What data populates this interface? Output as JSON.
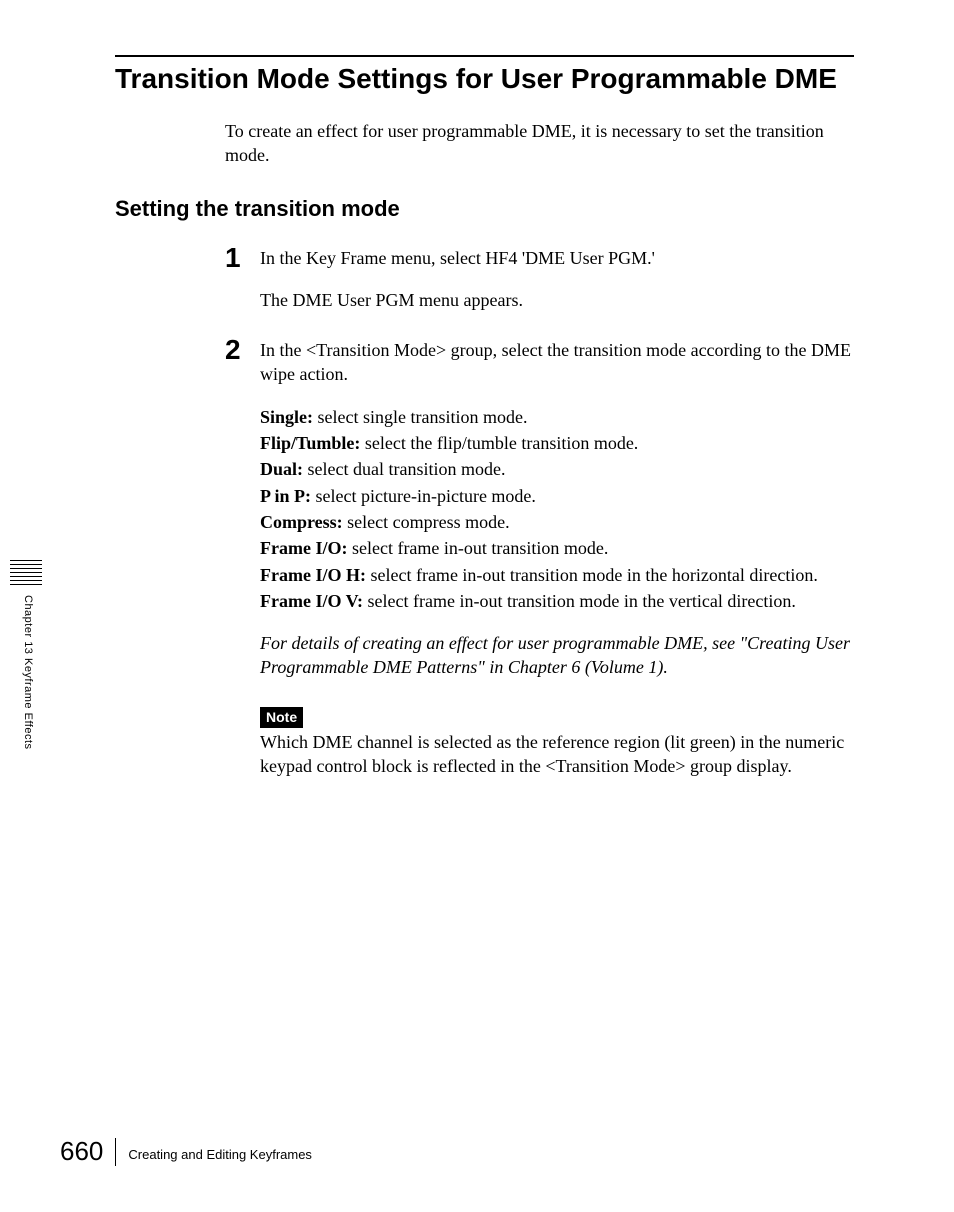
{
  "title": "Transition Mode Settings for User Programmable DME",
  "intro": "To create an effect for user programmable DME, it is necessary to set the transition mode.",
  "subhead": "Setting the transition mode",
  "step1": {
    "num": "1",
    "line1": "In the Key Frame menu, select HF4 'DME User PGM.'",
    "line2": "The DME User PGM menu appears."
  },
  "step2": {
    "num": "2",
    "intro": "In the <Transition Mode> group, select the transition mode according to the DME wipe action.",
    "defs": {
      "single_t": "Single:",
      "single_d": " select single transition mode.",
      "flip_t": "Flip/Tumble:",
      "flip_d": " select the flip/tumble transition mode.",
      "dual_t": "Dual:",
      "dual_d": " select dual transition mode.",
      "pinp_t": "P in P:",
      "pinp_d": " select picture-in-picture mode.",
      "comp_t": "Compress:",
      "comp_d": " select compress mode.",
      "fio_t": "Frame I/O:",
      "fio_d": " select frame in-out transition mode.",
      "fioh_t": "Frame I/O H:",
      "fioh_d": " select frame in-out transition mode in the horizontal direction.",
      "fiov_t": "Frame I/O V:",
      "fiov_d": " select frame in-out transition mode in the vertical direction."
    },
    "italic1": "For details of creating an effect for user programmable DME, see \"Creating User Programmable DME Patterns\" in Chapter 6 (Volume 1).",
    "note_label": "Note",
    "note_text": "Which DME channel is selected as the reference region (lit green) in the numeric keypad control block is reflected in the <Transition Mode> group display."
  },
  "side": "Chapter 13   Keyframe Effects",
  "footer": {
    "page": "660",
    "text": "Creating and Editing Keyframes"
  }
}
